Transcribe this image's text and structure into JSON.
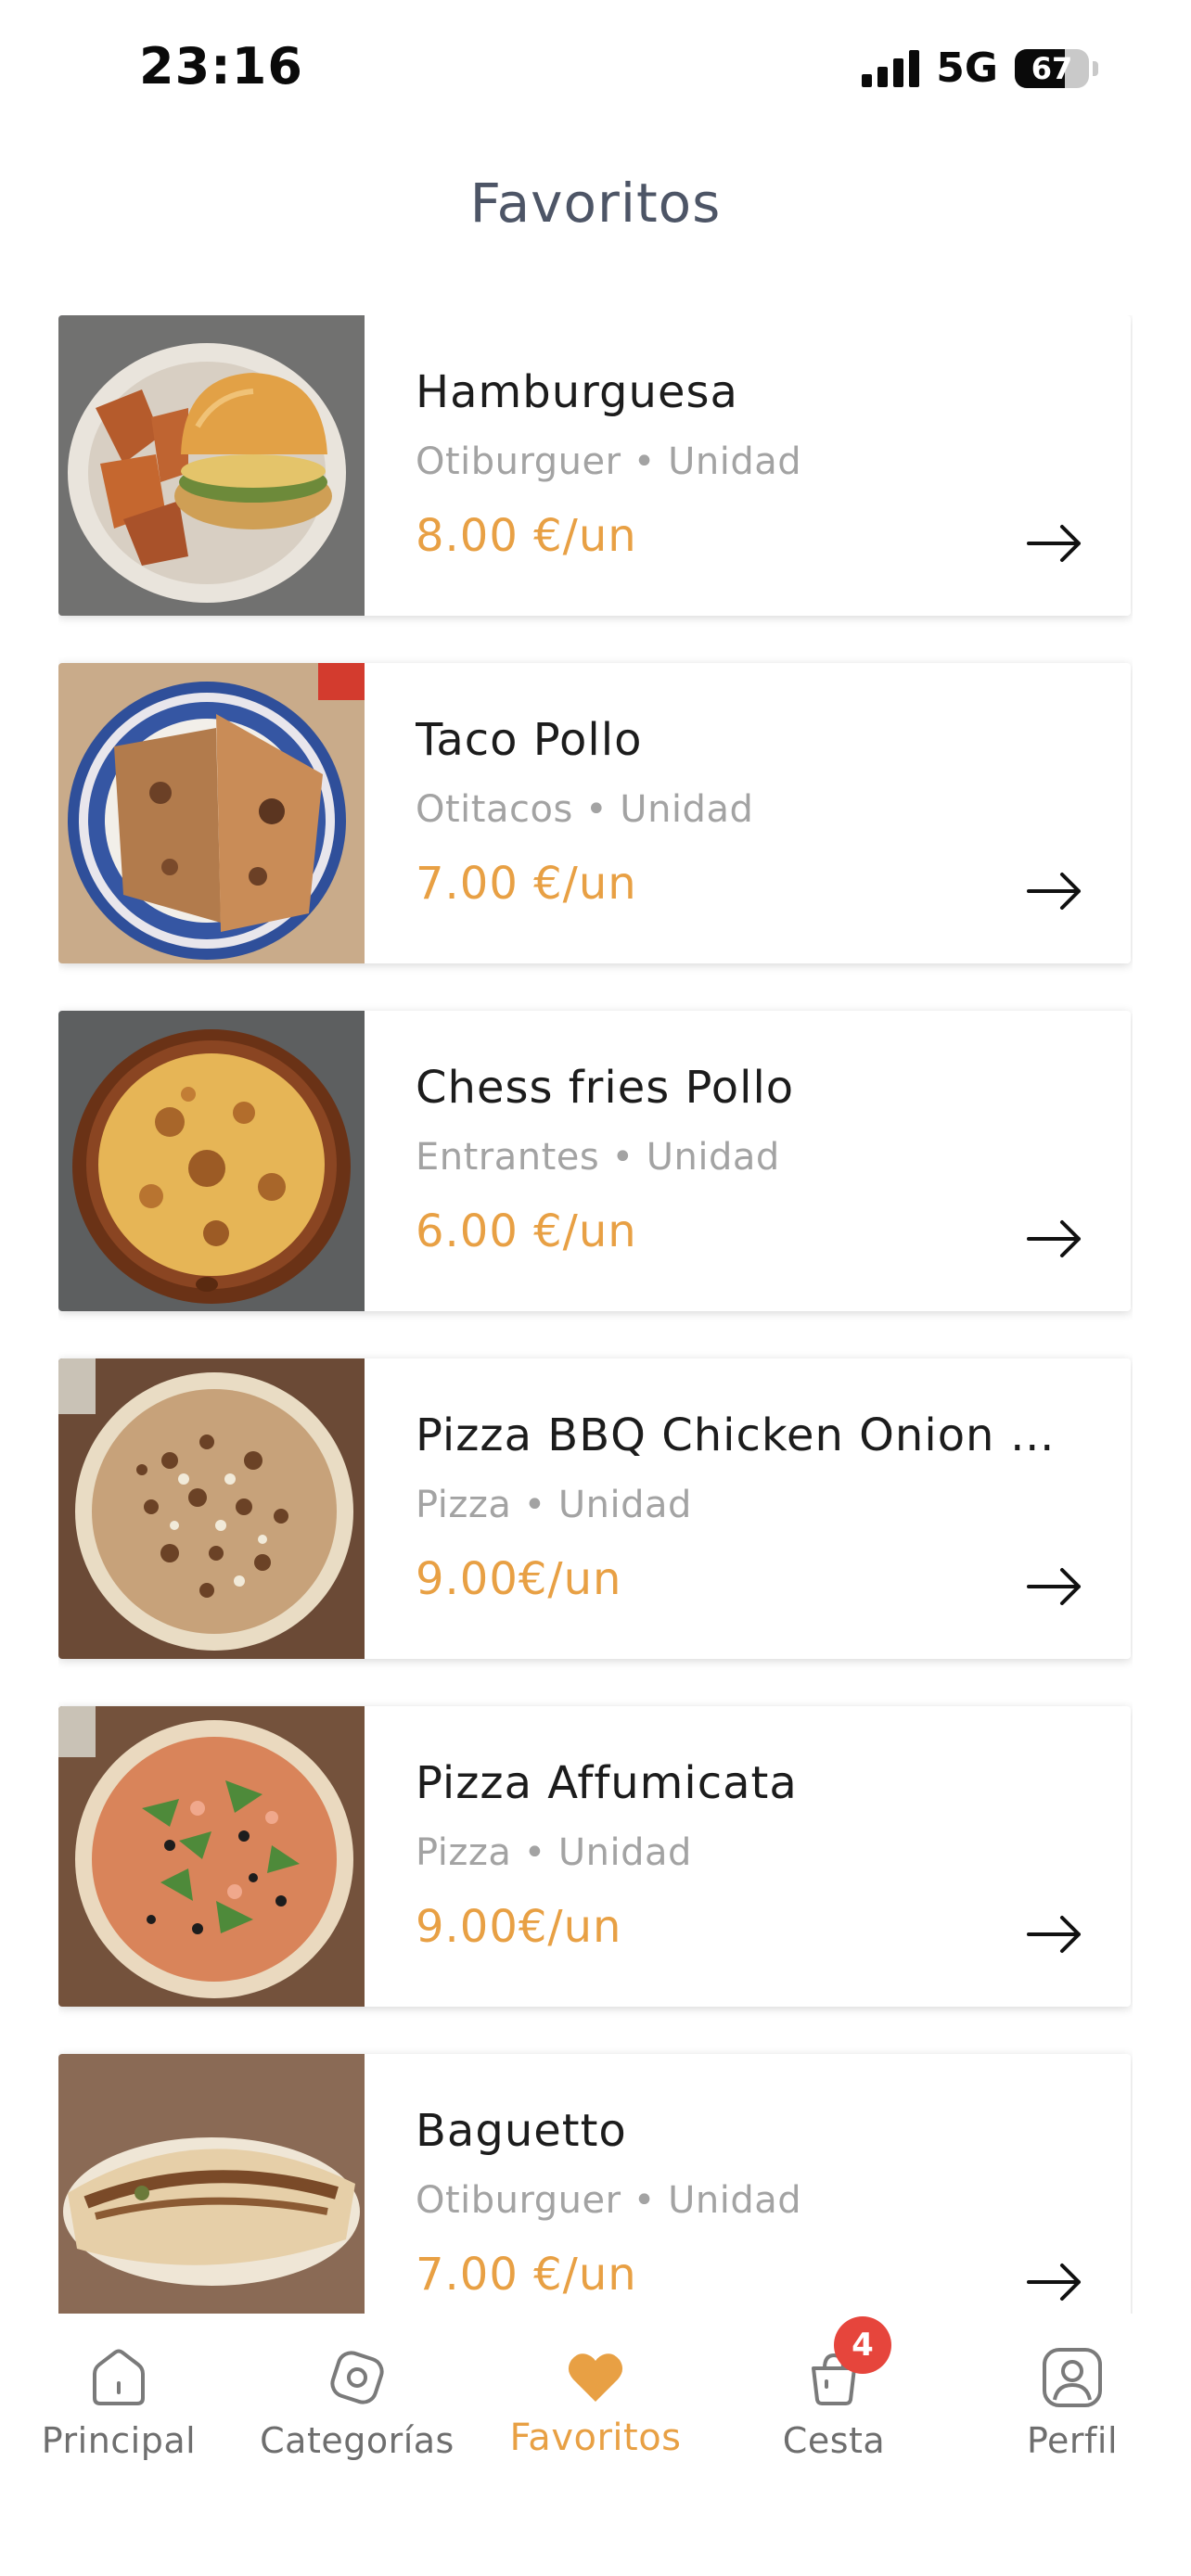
{
  "status_bar": {
    "time": "23:16",
    "network": "5G",
    "battery": "67",
    "battery_level": 0.67,
    "signal_bars": 4
  },
  "header": {
    "title": "Favoritos"
  },
  "favorites": [
    {
      "name": "Hamburguesa",
      "meta": "Otiburguer • Unidad",
      "price": "8.00 €/un",
      "image": "burger-with-sweet-potato-fries"
    },
    {
      "name": "Taco Pollo",
      "meta": "Otitacos • Unidad",
      "price": "7.00 €/un",
      "image": "taco-on-blue-plate"
    },
    {
      "name": "Chess fries Pollo",
      "meta": "Entrantes • Unidad",
      "price": "6.00 €/un",
      "image": "cheese-fries-clay-dish"
    },
    {
      "name": "Pizza BBQ Chicken Onion Cr…",
      "meta": "Pizza • Unidad",
      "price": "9.00€/un",
      "image": "bbq-chicken-pizza"
    },
    {
      "name": "Pizza Affumicata",
      "meta": "Pizza • Unidad",
      "price": "9.00€/un",
      "image": "salmon-arugula-pizza"
    },
    {
      "name": "Baguetto",
      "meta": "Otiburguer • Unidad",
      "price": "7.00 €/un",
      "image": "baguetto-flatbread"
    }
  ],
  "tab_bar": {
    "items": [
      {
        "label": "Principal",
        "icon": "home-icon"
      },
      {
        "label": "Categorías",
        "icon": "categories-icon"
      },
      {
        "label": "Favoritos",
        "icon": "heart-icon"
      },
      {
        "label": "Cesta",
        "icon": "basket-icon",
        "badge": "4"
      },
      {
        "label": "Perfil",
        "icon": "profile-icon"
      }
    ],
    "active": "Favoritos"
  },
  "colors": {
    "accent": "#e8a044",
    "title": "#4d5566",
    "meta": "#a3a3a3",
    "badge": "#e6453c",
    "inactive_tab": "#6e6e6e"
  }
}
